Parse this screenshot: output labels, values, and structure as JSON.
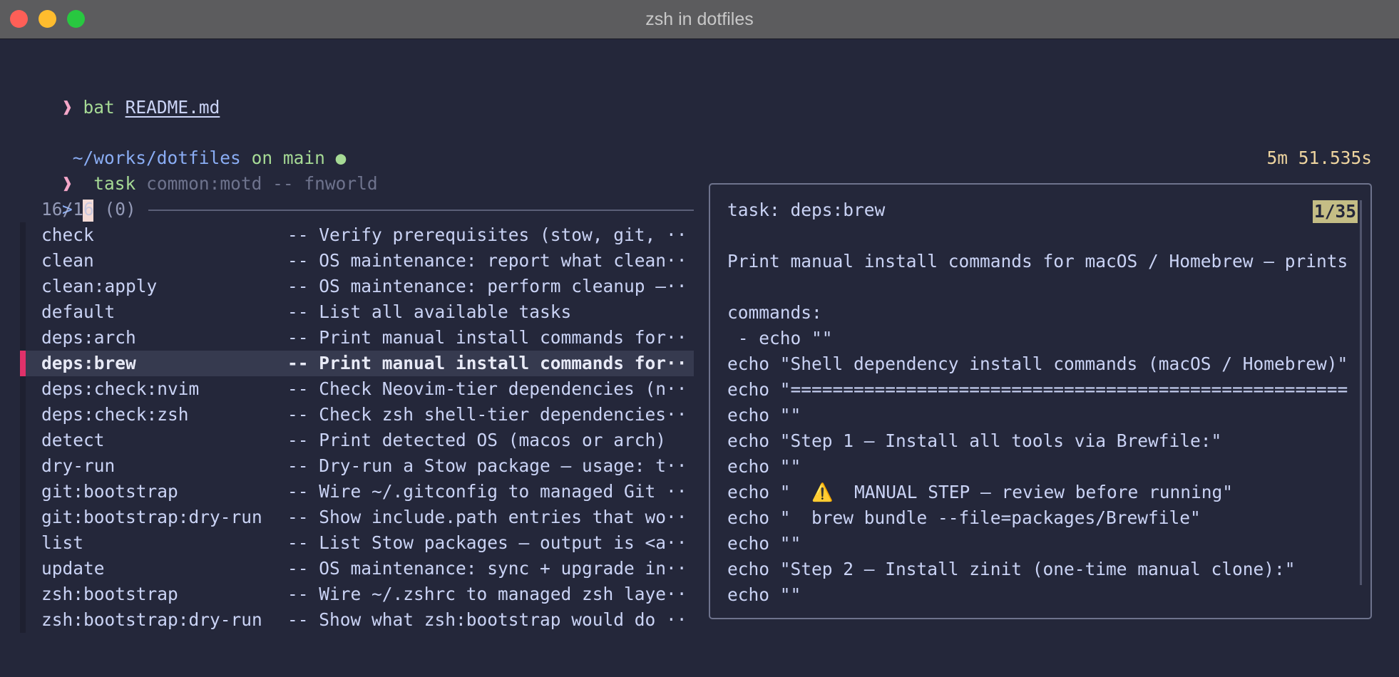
{
  "window": {
    "title": "zsh in dotfiles"
  },
  "shell": {
    "prompt_glyph": "❱",
    "cmd1": {
      "name": "bat",
      "arg": "README.md"
    },
    "path_line": {
      "apple": "",
      "cwd": "~/works/dotfiles",
      "on": "on",
      "branch_glyph": "",
      "branch": "main",
      "status_dot": "●"
    },
    "cmd2": {
      "name": "task",
      "args": "common:motd -- fnworld"
    },
    "elapsed": "5m 51.535s",
    "fzf_prompt": ">"
  },
  "fzf": {
    "counter": "16/16 (0)",
    "items": [
      {
        "name": "check",
        "desc": "-- Verify prerequisites (stow, git, ··"
      },
      {
        "name": "clean",
        "desc": "-- OS maintenance: report what clean··"
      },
      {
        "name": "clean:apply",
        "desc": "-- OS maintenance: perform cleanup —··"
      },
      {
        "name": "default",
        "desc": "-- List all available tasks"
      },
      {
        "name": "deps:arch",
        "desc": "-- Print manual install commands for··"
      },
      {
        "name": "deps:brew",
        "desc": "-- Print manual install commands for··",
        "selected": true
      },
      {
        "name": "deps:check:nvim",
        "desc": "-- Check Neovim-tier dependencies (n··"
      },
      {
        "name": "deps:check:zsh",
        "desc": "-- Check zsh shell-tier dependencies··"
      },
      {
        "name": "detect",
        "desc": "-- Print detected OS (macos or arch)"
      },
      {
        "name": "dry-run",
        "desc": "-- Dry-run a Stow package — usage: t··"
      },
      {
        "name": "git:bootstrap",
        "desc": "-- Wire ~/.gitconfig to managed Git ··"
      },
      {
        "name": "git:bootstrap:dry-run",
        "desc": "-- Show include.path entries that wo··"
      },
      {
        "name": "list",
        "desc": "-- List Stow packages — output is <a··"
      },
      {
        "name": "update",
        "desc": "-- OS maintenance: sync + upgrade in··"
      },
      {
        "name": "zsh:bootstrap",
        "desc": "-- Wire ~/.zshrc to managed zsh laye··"
      },
      {
        "name": "zsh:bootstrap:dry-run",
        "desc": "-- Show what zsh:bootstrap would do ··"
      }
    ]
  },
  "preview": {
    "pager": "1/35",
    "lines": [
      "task: deps:brew",
      "",
      "Print manual install commands for macOS / Homebrew — prints",
      "",
      "commands:",
      " - echo \"\"",
      "echo \"Shell dependency install commands (macOS / Homebrew)\"",
      "echo \"=====================================================",
      "echo \"\"",
      "echo \"Step 1 — Install all tools via Brewfile:\"",
      "echo \"\"",
      "echo \"  ⚠️  MANUAL STEP — review before running\"",
      "echo \"  brew bundle --file=packages/Brewfile\"",
      "echo \"\"",
      "echo \"Step 2 — Install zinit (one-time manual clone):\"",
      "echo \"\""
    ]
  },
  "colors": {
    "background": "#24273a",
    "titlebar": "#5c5c5e",
    "prompt_pink": "#f5a7c9",
    "command_green": "#a6da95",
    "path_blue": "#8aadf4",
    "elapsed_yellow": "#eed49f",
    "selection_marker": "#e0316a",
    "pager_highlight": "#c4bd85"
  },
  "icons": {
    "traffic_lights": [
      "close-icon",
      "minimize-icon",
      "zoom-icon"
    ],
    "os": "apple-icon",
    "branch": "git-branch-icon",
    "status": "status-dot-icon"
  }
}
